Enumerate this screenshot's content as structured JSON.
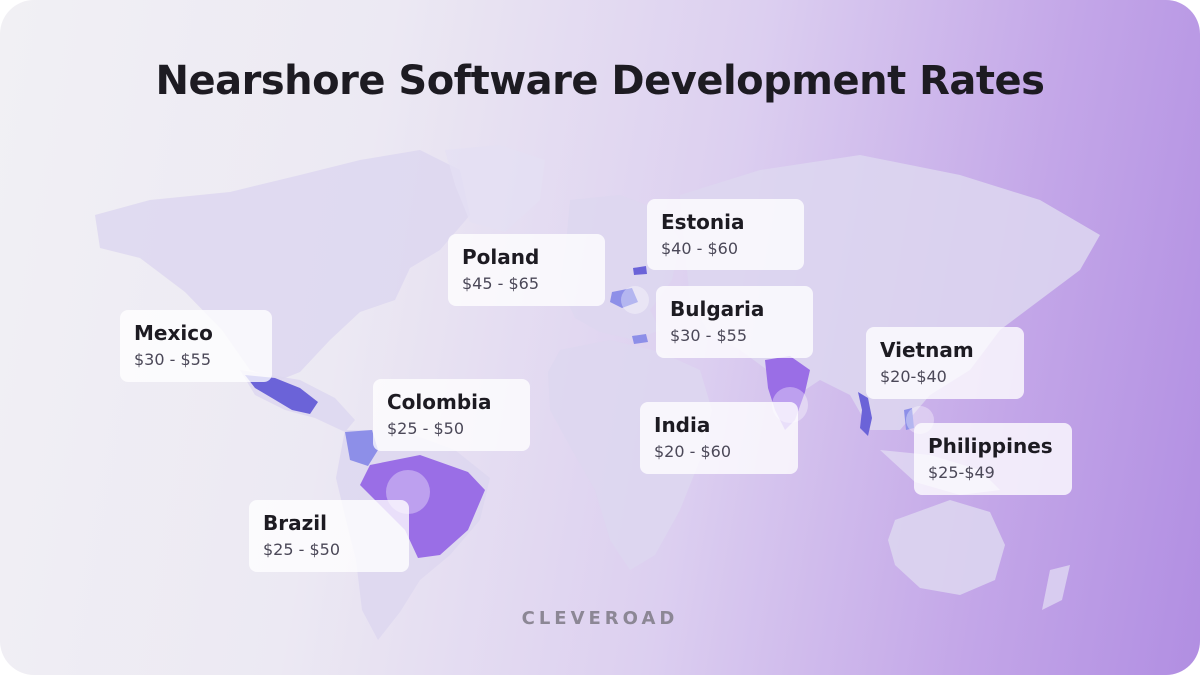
{
  "title": "Nearshore Software Development Rates",
  "brand": "CLEVEROAD",
  "colors": {
    "highlight_blue": "#6b63d8",
    "highlight_violet": "#9a6ee6",
    "land": "#ddd7f0"
  },
  "countries": [
    {
      "name": "Mexico",
      "rate": "$30 - $55"
    },
    {
      "name": "Colombia",
      "rate": "$25 - $50"
    },
    {
      "name": "Brazil",
      "rate": "$25 - $50"
    },
    {
      "name": "Poland",
      "rate": "$45 - $65"
    },
    {
      "name": "Estonia",
      "rate": "$40 - $60"
    },
    {
      "name": "Bulgaria",
      "rate": "$30 - $55"
    },
    {
      "name": "India",
      "rate": "$20 - $60"
    },
    {
      "name": "Vietnam",
      "rate": "$20-$40"
    },
    {
      "name": "Philippines",
      "rate": "$25-$49"
    }
  ]
}
